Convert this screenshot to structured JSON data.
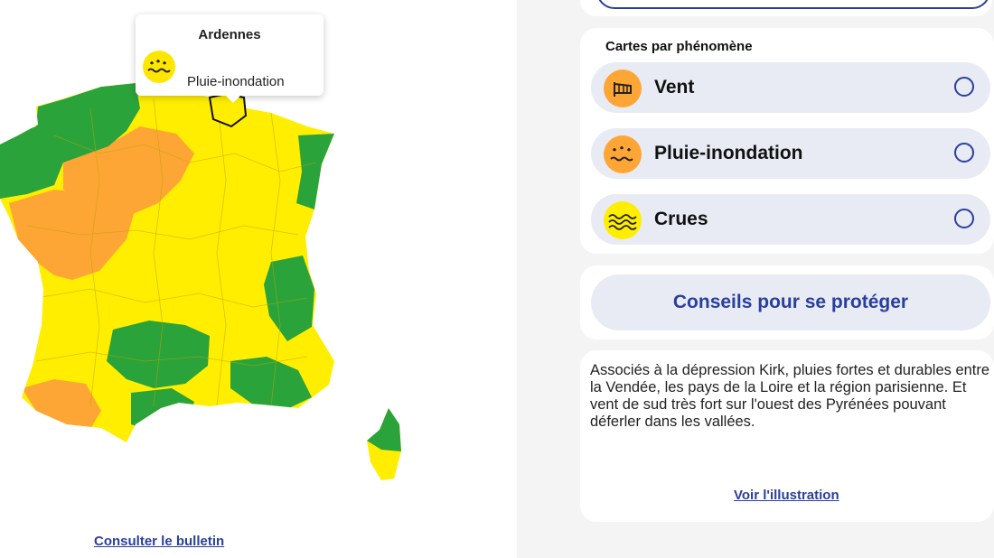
{
  "map": {
    "alert_colors": {
      "green": "#2aa33a",
      "yellow": "#ffee00",
      "orange": "#fda636"
    },
    "tooltip": {
      "department": "Ardennes",
      "phenomenon": "Pluie-inondation",
      "icon": "rain-flood-icon"
    },
    "bulletin_link": "Consulter le bulletin"
  },
  "panel": {
    "phenomena_title": "Cartes par phénomène",
    "phenomena": [
      {
        "label": "Vent",
        "icon": "wind-icon",
        "color": "#fda636"
      },
      {
        "label": "Pluie-inondation",
        "icon": "rain-flood-icon",
        "color": "#fda636"
      },
      {
        "label": "Crues",
        "icon": "flood-waves-icon",
        "color": "#ffee00"
      }
    ],
    "advice_button": "Conseils pour se protéger",
    "description": "Associés à la dépression Kirk, pluies fortes et durables entre la Vendée, les pays de la Loire et la région parisienne. Et vent de sud très fort sur l'ouest des Pyrénées pouvant déferler dans les vallées.",
    "illustration_link": "Voir l'illustration"
  }
}
